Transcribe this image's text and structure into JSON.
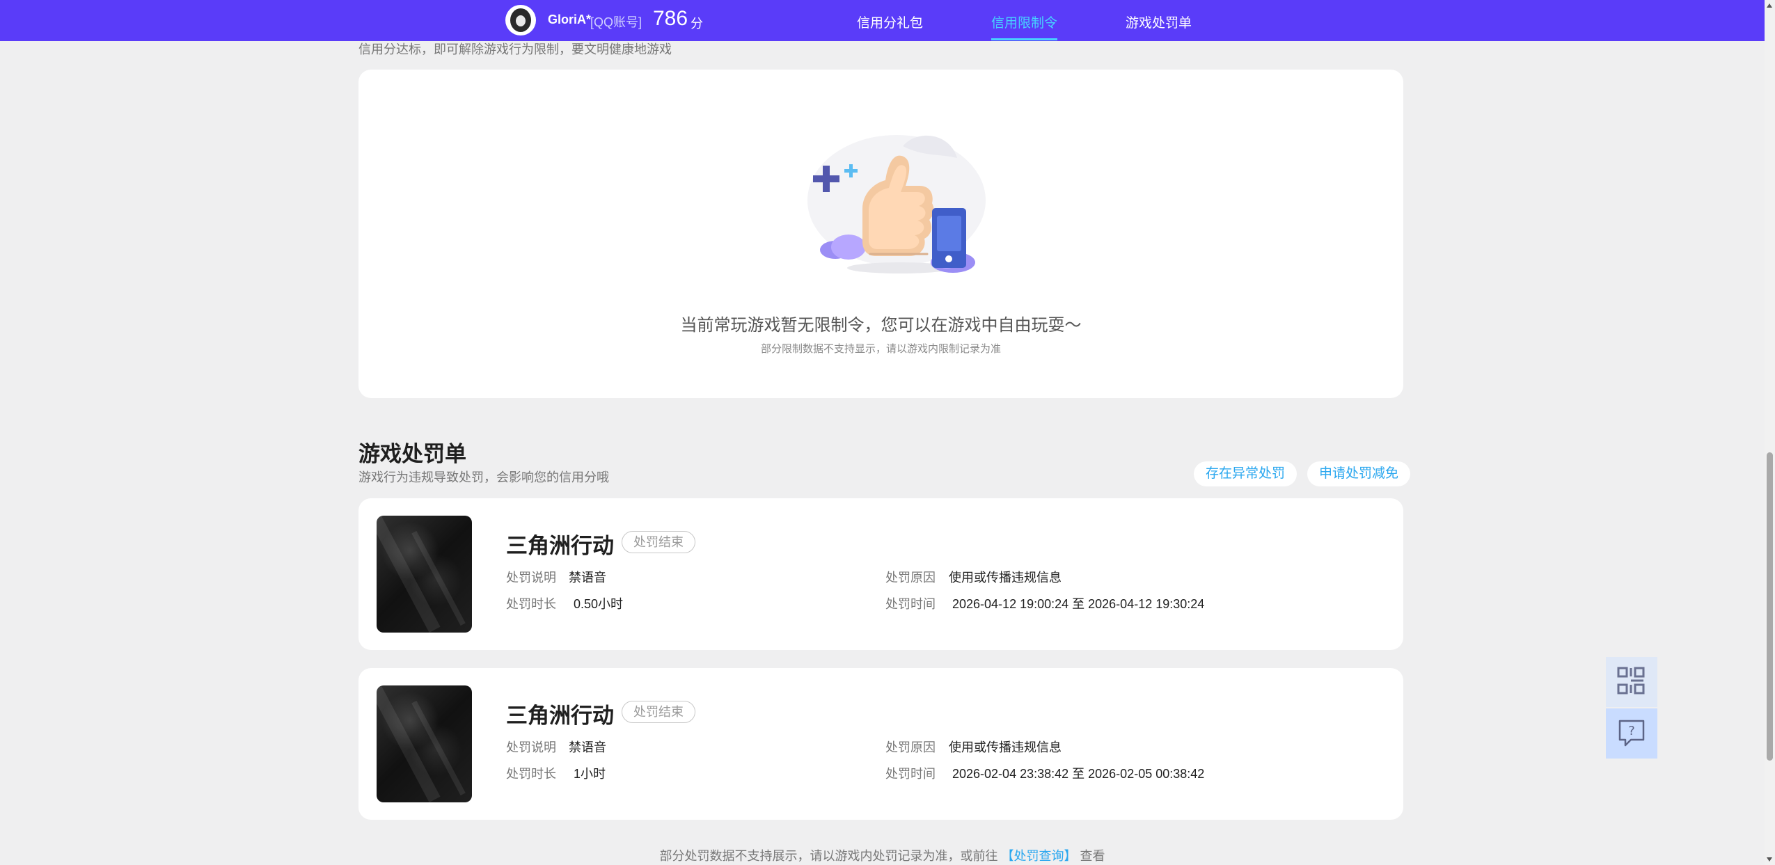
{
  "header": {
    "user_name": "GloriA*",
    "account_type": "[QQ账号]",
    "score": "786",
    "score_unit": "分",
    "tabs": [
      {
        "label": "信用分礼包",
        "active": false
      },
      {
        "label": "信用限制令",
        "active": true
      },
      {
        "label": "游戏处罚单",
        "active": false
      }
    ],
    "colors": {
      "nav_background": "#5a3cf9",
      "active_tab": "#47d1ff"
    }
  },
  "restriction": {
    "subtitle": "信用分达标，即可解除游戏行为限制，要文明健康地游戏",
    "empty_title": "当前常玩游戏暂无限制令，您可以在游戏中自由玩耍～",
    "empty_note": "部分限制数据不支持显示，请以游戏内限制记录为准"
  },
  "punishments": {
    "title": "游戏处罚单",
    "subtitle": "游戏行为违规导致处罚，会影响您的信用分哦",
    "actions": {
      "abnormal": "存在异常处罚",
      "reduction": "申请处罚减免"
    },
    "items": [
      {
        "game": "三角洲行动",
        "status": "处罚结束",
        "description_label": "处罚说明",
        "description": "禁语音",
        "duration_label": "处罚时长",
        "duration": "0.50小时",
        "reason_label": "处罚原因",
        "reason": "使用或传播违规信息",
        "time_label": "处罚时间",
        "time": "2026-04-12 19:00:24 至 2026-04-12 19:30:24"
      },
      {
        "game": "三角洲行动",
        "status": "处罚结束",
        "description_label": "处罚说明",
        "description": "禁语音",
        "duration_label": "处罚时长",
        "duration": "1小时",
        "reason_label": "处罚原因",
        "reason": "使用或传播违规信息",
        "time_label": "处罚时间",
        "time": "2026-02-04 23:38:42 至 2026-02-05 00:38:42"
      }
    ],
    "footer_prefix": "部分处罚数据不支持展示，请以游戏内处罚记录为准，或前往",
    "footer_link": "【处罚查询】",
    "footer_suffix": "查看"
  },
  "sidebar": {
    "qr_icon": "qr-code-icon",
    "help_icon": "help-chat-icon"
  }
}
